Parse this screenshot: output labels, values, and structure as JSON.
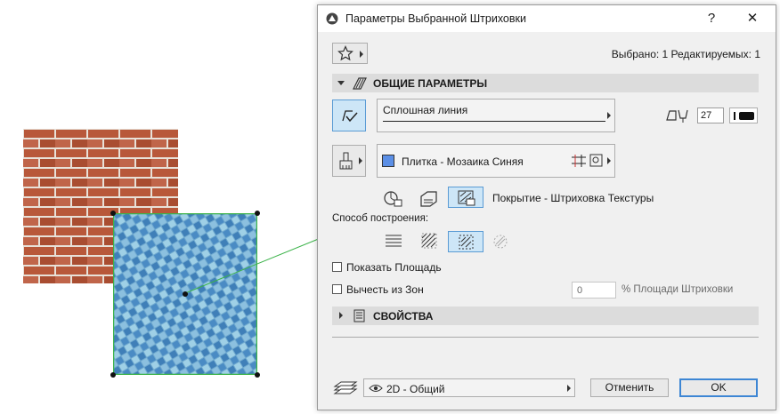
{
  "dialog": {
    "title": "Параметры Выбранной Штриховки",
    "help_label": "?",
    "close_label": "✕",
    "selection_info": "Выбрано: 1 Редактируемых: 1"
  },
  "general_section": {
    "title": "ОБЩИЕ ПАРАМЕТРЫ"
  },
  "line_type": {
    "value": "Сплошная линия"
  },
  "pen": {
    "value": "27"
  },
  "fill": {
    "name": "Плитка - Мозаика Синяя",
    "swatch_color": "#5b8fe6"
  },
  "fill_mode": {
    "label": "Покрытие - Штриховка Текстуры"
  },
  "construction": {
    "label": "Способ построения:"
  },
  "show_area": {
    "label": "Показать Площадь",
    "checked": false
  },
  "subtract_zones": {
    "label": "Вычесть из Зон",
    "checked": false,
    "value": "0",
    "suffix": "% Площади Штриховки"
  },
  "properties_section": {
    "title": "СВОЙСТВА"
  },
  "layer": {
    "value": "2D - Общий"
  },
  "buttons": {
    "cancel": "Отменить",
    "ok": "OK"
  },
  "colors": {
    "accent": "#5a9bd4",
    "selection_line": "#3cb34a"
  }
}
